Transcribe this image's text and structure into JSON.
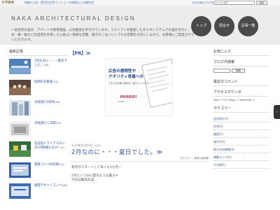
{
  "topbar": {
    "logo": "©TIDA",
    "links": "沖縄の土地・建売住宅等マンションの情報なら沖縄住宅",
    "user_link": "今日の無料ブログを開く",
    "search_placeholder": "Google 検索",
    "search_button": "検索"
  },
  "header": {
    "title": "NAKA ARCHITECTURAL DESIGN",
    "description": "一般住宅の設計、アパートや教育施設、公共施設を手がけています。３Ｄソフトを駆使したＢＩＭシステムでの設計を行い、光・風・緑などの自然を享受した心地よい快適な空間、飽きのこないシンプルな空間を大切にしながら、お客様にご提案させていただきます。",
    "nav": [
      "トップ",
      "問合せ",
      "記事一覧"
    ]
  },
  "left": {
    "heading": "最新記事",
    "posts": [
      {
        "title": "2月なのに・・・夏日でした。",
        "count": "(20)"
      },
      {
        "title": "恒例の交歓会",
        "count": "(14)"
      },
      {
        "title": "大阪旅行3日目",
        "count": "(16)"
      },
      {
        "title": "大阪旅行１日目",
        "count": "(22)"
      },
      {
        "title": "石垣島トライアスロン2019開催なるか？",
        "count": "(5)"
      },
      {
        "title": "建築コンペの結果",
        "count": "(15)"
      },
      {
        "title": "建築デザインコンペ",
        "count": "(26)"
      }
    ]
  },
  "main": {
    "pr_heading": "【PR】≫",
    "ad": {
      "line1": "広告の透明性や",
      "line2": "クオリティ改善への",
      "line3": "さまざまな取り組みをご紹介しています。",
      "brand": "YAHOO!",
      "brand_sub": "JAPAN"
    },
    "post": {
      "date": "2019年02月02日 14:51",
      "title": "2月なのに・・・夏日でした。≫",
      "meta": "カテゴリー｜休日の出来事",
      "body1": "新年がスタートして早くも1カ月☆",
      "body2": "2月というのに夏のような暑さ☀",
      "body3": "今日は最高気温…"
    }
  },
  "right": {
    "fav_heading": "お気に入り",
    "blog_search_heading": "ブログ内検索",
    "search_button": "検索",
    "comments_heading": "最近のコメント",
    "counter_heading": "アクセスカウンタ",
    "counter_text": "Total: 1725  Today: 0  Yesterday: 0",
    "categories_heading": "カテゴリー",
    "categories": [
      {
        "name": "会社紹介",
        "count": "(1)"
      },
      {
        "name": "住宅",
        "count": "(1)"
      },
      {
        "name": "施設",
        "count": "(1)"
      },
      {
        "name": "旅行",
        "count": "(14)"
      },
      {
        "name": "休日の出来事",
        "count": "(4)"
      },
      {
        "name": "建築コンペ",
        "count": "(2)"
      },
      {
        "name": "その他",
        "count": "(1)"
      }
    ]
  },
  "colors": {
    "link": "#2f53a0",
    "header_bg": "#ececec",
    "nav_circle": "#4a4a4a",
    "ad_brand": "#c0172d"
  }
}
